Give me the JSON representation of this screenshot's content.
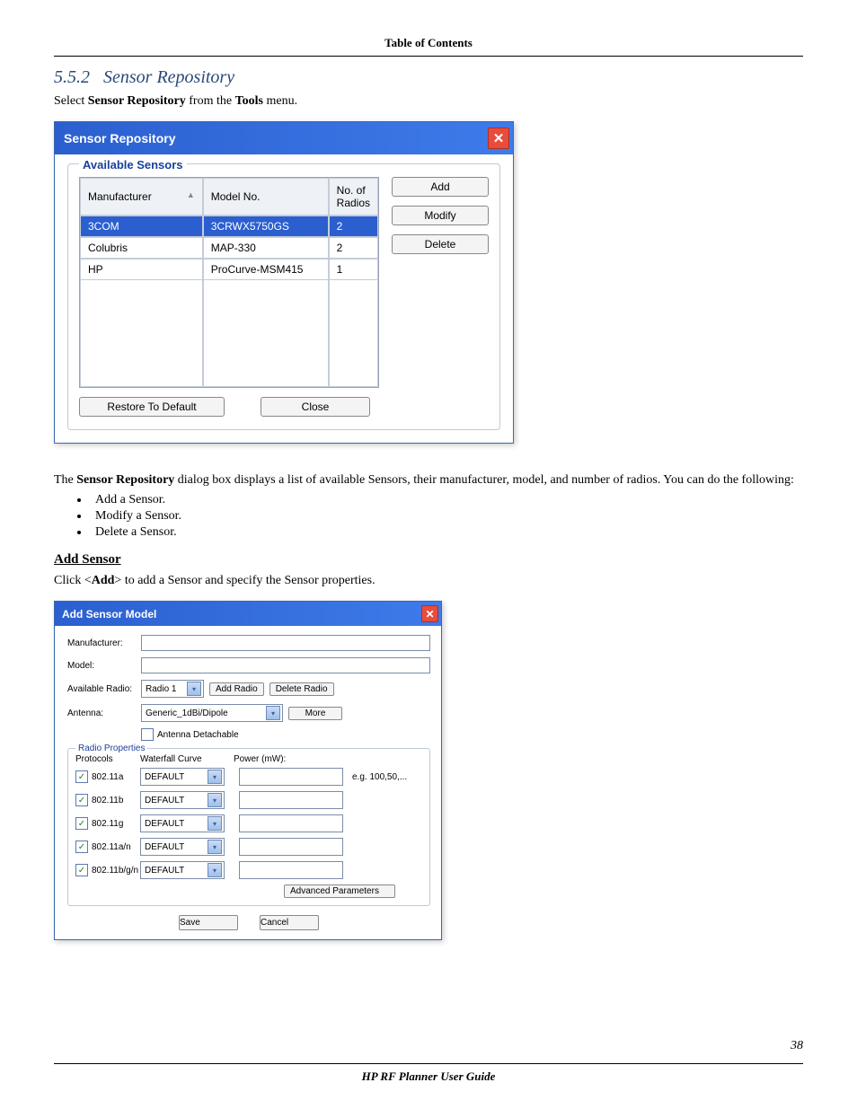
{
  "header": {
    "toc": "Table of Contents"
  },
  "section": {
    "number": "5.5.2",
    "title": "Sensor Repository",
    "intro_pre": "Select ",
    "intro_b1": "Sensor Repository",
    "intro_mid": " from the ",
    "intro_b2": "Tools",
    "intro_post": " menu."
  },
  "repo_dialog": {
    "title": "Sensor Repository",
    "legend": "Available Sensors",
    "columns": {
      "manufacturer": "Manufacturer",
      "model": "Model No.",
      "radios": "No. of Radios"
    },
    "rows": [
      {
        "manufacturer": "3COM",
        "model": "3CRWX5750GS",
        "radios": "2",
        "selected": true
      },
      {
        "manufacturer": "Colubris",
        "model": "MAP-330",
        "radios": "2",
        "selected": false
      },
      {
        "manufacturer": "HP",
        "model": "ProCurve-MSM415",
        "radios": "1",
        "selected": false
      }
    ],
    "buttons": {
      "add": "Add",
      "modify": "Modify",
      "delete": "Delete",
      "restore": "Restore To Default",
      "close": "Close"
    }
  },
  "para2_pre": "The ",
  "para2_b": "Sensor Repository",
  "para2_post": " dialog box displays a list of available Sensors, their manufacturer, model, and number of radios. You can do the following:",
  "bullets": [
    "Add a Sensor.",
    "Modify a Sensor.",
    "Delete a Sensor."
  ],
  "add_sensor": {
    "heading": "Add Sensor",
    "line_pre": "Click <",
    "line_b": "Add",
    "line_post": "> to add a Sensor and specify the Sensor properties."
  },
  "add_dialog": {
    "title": "Add Sensor Model",
    "labels": {
      "manufacturer": "Manufacturer:",
      "model": "Model:",
      "available_radio": "Available Radio:",
      "antenna": "Antenna:"
    },
    "radio_value": "Radio 1",
    "add_radio_btn": "Add Radio",
    "delete_radio_btn": "Delete Radio",
    "antenna_value": "Generic_1dBi/Dipole",
    "more_btn": "More",
    "detachable_label": "Antenna Detachable",
    "radio_props_legend": "Radio Properties",
    "proto_header": {
      "protocols": "Protocols",
      "waterfall": "Waterfall Curve",
      "power": "Power (mW):"
    },
    "protocols": [
      {
        "label": "802.11a",
        "curve": "DEFAULT",
        "hint": "e.g. 100,50,..."
      },
      {
        "label": "802.11b",
        "curve": "DEFAULT",
        "hint": ""
      },
      {
        "label": "802.11g",
        "curve": "DEFAULT",
        "hint": ""
      },
      {
        "label": "802.11a/n",
        "curve": "DEFAULT",
        "hint": ""
      },
      {
        "label": "802.11b/g/n",
        "curve": "DEFAULT",
        "hint": ""
      }
    ],
    "advanced_btn": "Advanced Parameters",
    "save_btn": "Save",
    "cancel_btn": "Cancel"
  },
  "footer": {
    "page_no": "38",
    "guide": "HP RF Planner User Guide"
  }
}
